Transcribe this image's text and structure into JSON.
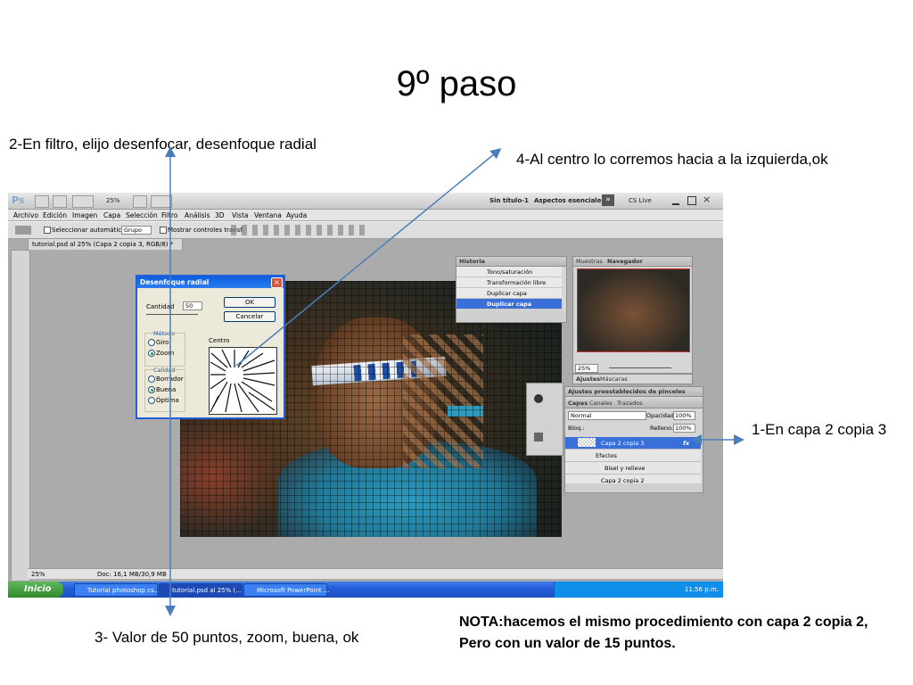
{
  "slide": {
    "title": "9º paso",
    "step2": "2-En filtro, elijo desenfocar, desenfoque radial",
    "step4": "4-Al centro lo corremos hacia a la izquierda,ok",
    "step1": "1-En capa 2 copia 3",
    "step3": "3- Valor de 50 puntos, zoom, buena, ok",
    "note_line1": "NOTA:hacemos el mismo procedimiento con capa 2 copia 2,",
    "note_line2": "Pero con un valor de 15 puntos."
  },
  "photoshop": {
    "logo": "Ps",
    "zoom": "25%",
    "file_title": "Sin título-1",
    "workspace": "Aspectos esenciales",
    "cs_live": "CS Live",
    "menu": [
      "Archivo",
      "Edición",
      "Imagen",
      "Capa",
      "Selección",
      "Filtro",
      "Análisis",
      "3D",
      "Vista",
      "Ventana",
      "Ayuda"
    ],
    "options": {
      "auto_select": "Seleccionar automáticamente:",
      "group_value": "Grupo",
      "show_transform": "Mostrar controles transf."
    },
    "doc_tab": "tutorial.psd al 25% (Capa 2 copia 3, RGB/8) *",
    "status_zoom": "25%",
    "status_doc": "Doc: 16,1 MB/30,9 MB"
  },
  "dialog": {
    "title": "Desenfoque radial",
    "amount_label": "Cantidad",
    "amount_value": "50",
    "ok": "OK",
    "cancel": "Cancelar",
    "method_label": "Método",
    "method_spin": "Giro",
    "method_zoom": "Zoom",
    "center_label": "Centro",
    "quality_label": "Calidad",
    "quality_draft": "Borrador",
    "quality_good": "Buena",
    "quality_best": "Óptima"
  },
  "history": {
    "tab": "Historia",
    "items": [
      "Tono/saturación",
      "Transformación libre",
      "Duplicar capa",
      "Duplicar capa"
    ]
  },
  "navigator": {
    "tab_samples": "Muestras",
    "tab_navigator": "Navegador",
    "zoom": "25%"
  },
  "adjust": {
    "tab_adjust": "Ajustes",
    "tab_masks": "Máscaras",
    "brush_presets": "Ajustes preestablecidos de pinceles"
  },
  "layers": {
    "tab_layers": "Capas",
    "tab_channels": "Canales",
    "tab_paths": "Trazados",
    "blend_mode": "Normal",
    "opacity_label": "Opacidad:",
    "opacity_value": "100%",
    "lock_label": "Bloq.:",
    "fill_label": "Relleno:",
    "fill_value": "100%",
    "rows": [
      "Capa 2 copia 3",
      "Efectos",
      "Bisel y relieve",
      "Capa 2 copia 2"
    ]
  },
  "taskbar": {
    "start": "Inicio",
    "tasks": [
      "Tutorial photoshop cs...",
      "tutorial.psd al 25% (...",
      "Microsoft PowerPoint ..."
    ],
    "clock": "11:56 p.m."
  }
}
